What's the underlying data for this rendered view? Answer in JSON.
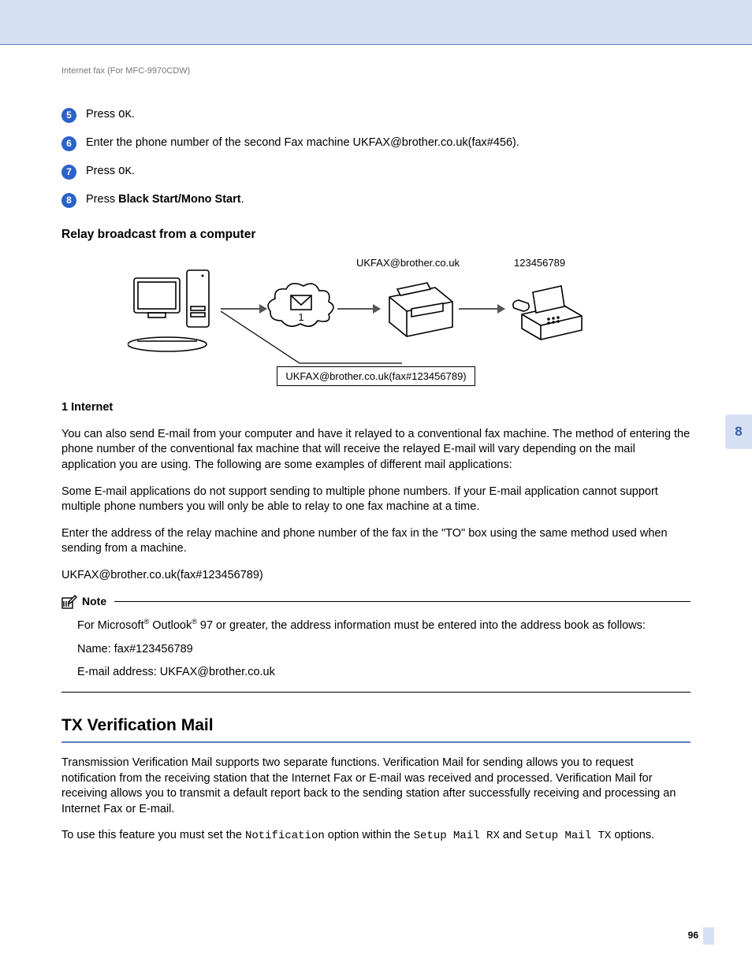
{
  "running_header": "Internet fax (For MFC-9970CDW)",
  "steps": [
    {
      "num": "5",
      "prefix": "Press ",
      "mono": "OK",
      "suffix": "."
    },
    {
      "num": "6",
      "text": "Enter the phone number of the second Fax machine UKFAX@brother.co.uk(fax#456)."
    },
    {
      "num": "7",
      "prefix": "Press ",
      "mono": "OK",
      "suffix": "."
    },
    {
      "num": "8",
      "prefix": "Press ",
      "bold": "Black Start/Mono Start",
      "suffix": "."
    }
  ],
  "h3_relay": "Relay broadcast from a computer",
  "diagram": {
    "center_num": "1",
    "label_ukfax": "UKFAX@brother.co.uk",
    "label_num": "123456789",
    "callout": "UKFAX@brother.co.uk(fax#123456789)"
  },
  "legend": "1   Internet",
  "paras": [
    "You can also send E-mail from your computer and have it relayed to a conventional fax machine. The method of entering the phone number of the conventional fax machine that will receive the relayed E-mail will vary depending on the mail application you are using. The following are some examples of different mail applications:",
    "Some E-mail applications do not support sending to multiple phone numbers. If your E-mail application cannot support multiple phone numbers you will only be able to relay to one fax machine at a time.",
    "Enter the address of the relay machine and phone number of the fax in the \"TO\" box using the same method used when sending from a machine.",
    "UKFAX@brother.co.uk(fax#123456789)"
  ],
  "note": {
    "title": "Note",
    "line1_a": "For Microsoft",
    "line1_b": " Outlook",
    "line1_c": " 97 or greater, the address information must be entered into the address book as follows:",
    "line2": "Name: fax#123456789",
    "line3": "E-mail address: UKFAX@brother.co.uk"
  },
  "h2_tx": "TX Verification Mail",
  "tx_para1": "Transmission Verification Mail supports two separate functions. Verification Mail for sending allows you to request notification from the receiving station that the Internet Fax or E-mail was received and processed. Verification Mail for receiving allows you to transmit a default report back to the sending station after successfully receiving and processing an Internet Fax or E-mail.",
  "tx_para2_a": "To use this feature you must set the ",
  "tx_para2_b": "Notification",
  "tx_para2_c": " option within the ",
  "tx_para2_d": "Setup Mail RX",
  "tx_para2_e": " and ",
  "tx_para2_f": "Setup Mail TX",
  "tx_para2_g": " options.",
  "side_tab": "8",
  "page_num": "96"
}
